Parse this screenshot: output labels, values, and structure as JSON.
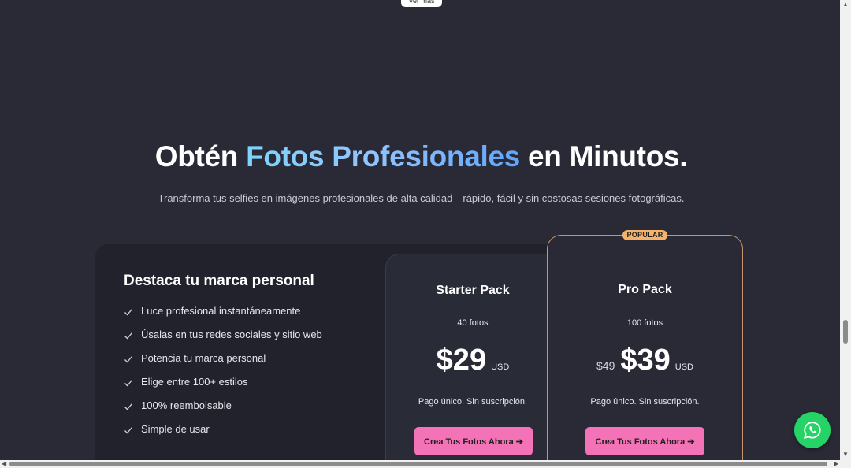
{
  "top_pill": {
    "label": "Ver más"
  },
  "hero": {
    "headline_start": "Obtén ",
    "headline_highlight": "Fotos Profesionales",
    "headline_end": " en Minutos.",
    "subheadline": "Transforma tus selfies en imágenes profesionales de alta calidad—rápido, fácil y sin costosas sesiones fotográficas."
  },
  "benefits": {
    "title": "Destaca tu marca personal",
    "items": [
      "Luce profesional instantáneamente",
      "Úsalas en tus redes sociales y sitio web",
      "Potencia tu marca personal",
      "Elige entre 100+ estilos",
      "100% reembolsable",
      "Simple de usar"
    ]
  },
  "plans": [
    {
      "name": "Starter Pack",
      "photos": "40 fotos",
      "price": "$29",
      "currency": "USD",
      "note": "Pago único. Sin suscripción.",
      "cta": "Crea Tus Fotos Ahora ➔"
    },
    {
      "badge": "POPULAR",
      "name": "Pro Pack",
      "photos": "100 fotos",
      "old_price": "$49",
      "price": "$39",
      "currency": "USD",
      "note": "Pago único. Sin suscripción.",
      "cta": "Crea Tus Fotos Ahora ➔"
    }
  ],
  "icons": {
    "check": "check-icon",
    "whatsapp": "whatsapp-icon"
  },
  "colors": {
    "background": "#292a35",
    "accent_gradient_start": "#7dd3fc",
    "accent_gradient_end": "#60a5fa",
    "cta": "#f472b6",
    "popular_badge": "#f6b26b",
    "whatsapp": "#25d366"
  }
}
